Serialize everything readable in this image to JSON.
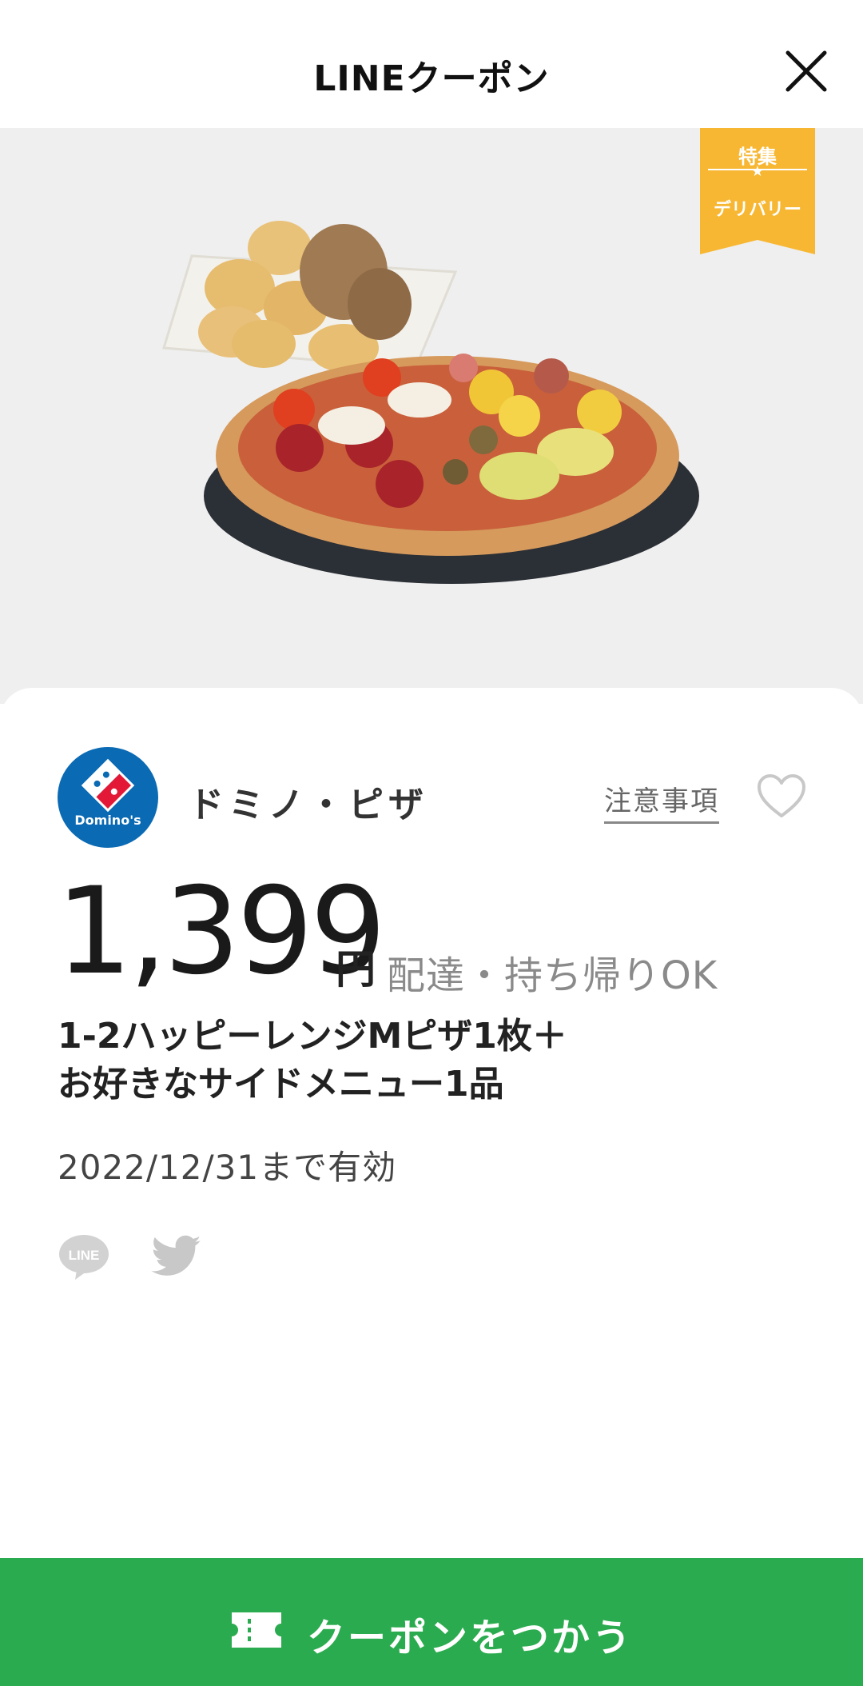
{
  "header": {
    "title": "LINEクーポン",
    "close_icon": "close-icon"
  },
  "hero": {
    "image_description_icon": "pizza-and-chicken-image",
    "badge": {
      "top_label": "特集",
      "bottom_label": "デリバリー",
      "color": "#f7b733"
    }
  },
  "shop": {
    "logo_text": "Domino's",
    "name": "ドミノ・ピザ",
    "notes_link": "注意事項",
    "brand_color": "#0a6ab3"
  },
  "offer": {
    "price": "1,399",
    "currency": "円",
    "delivery_note": "配達・持ち帰りOK",
    "description_line1": "1-2ハッピーレンジMピザ1枚＋",
    "description_line2": "お好きなサイドメニュー1品",
    "validity": "2022/12/31まで有効"
  },
  "share": {
    "line_icon": "line-share-icon",
    "twitter_icon": "twitter-share-icon"
  },
  "cta": {
    "label": "クーポンをつかう",
    "color": "#2bab4f"
  }
}
